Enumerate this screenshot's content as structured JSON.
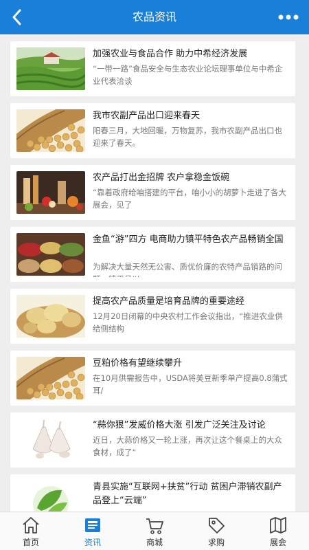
{
  "header": {
    "title": "农品资讯",
    "back_icon": "back-arrow-icon",
    "more_icon": "more-dots-icon",
    "color": "#1a7fd8"
  },
  "articles": [
    {
      "title": "加强农业与食品合作 助力中希经济发展",
      "desc": "“一带一路”食品安全与生态农业论坛理事单位与中希企业代表洽谈",
      "image": "tea-plantation"
    },
    {
      "title": "我市农副产品出口迎来春天",
      "desc": "阳春三月，大地回暖，万物复苏，我市农副产品出口也迎来了春天。",
      "image": "soybeans-basket"
    },
    {
      "title": "农产品打出金招牌 农户拿稳金饭碗",
      "desc": "“靠着政府给咱搭建的平台，咱小小的胡萝卜走进了各大展会，见了",
      "image": "produce-display"
    },
    {
      "title": "金鱼“游”四方 电商助力镇平特色农产品畅销全国",
      "desc": "为解决大量天然无公害、质优价廉的农特产品销路的问题，镇平县以",
      "image": "market-baskets"
    },
    {
      "title": "提高农产品质量是培育品牌的重要途经",
      "desc": "12月20日闭幕的中央农村工作会议指出，“推进农业供给侧结构",
      "image": "potatoes"
    },
    {
      "title": "豆粕价格有望继续攀升",
      "desc": "在10月供需报告中，USDA将美豆新季单产提高0.8蒲式耳/",
      "image": "soybeans-basket"
    },
    {
      "title": "“蒜你狠”发威价格大涨 引发广泛关注及讨论",
      "desc": "近日，大蒜价格又一轮上涨，再次让这个餐桌上的大众食材，成了“",
      "image": "garlic"
    },
    {
      "title": "青县实施“互联网+扶贫”行动 贫困户滞销农副产品登上“云端”",
      "desc": "",
      "image": "green-logo"
    }
  ],
  "tabs": [
    {
      "label": "首页",
      "icon": "home-icon"
    },
    {
      "label": "资讯",
      "icon": "news-icon"
    },
    {
      "label": "商城",
      "icon": "cart-icon"
    },
    {
      "label": "求购",
      "icon": "tag-icon"
    },
    {
      "label": "展会",
      "icon": "map-icon"
    }
  ],
  "active_tab": "资讯",
  "colors": {
    "accent": "#1a7fd8",
    "title_text": "#222222",
    "desc_text": "#777777",
    "background": "#eeeeee"
  }
}
